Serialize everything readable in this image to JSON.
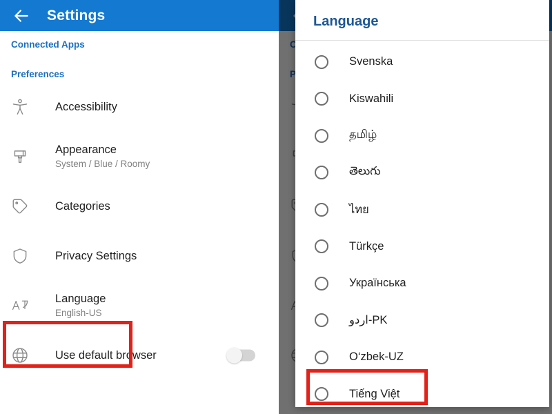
{
  "app": {
    "title": "Settings",
    "back_icon": "back-arrow-icon",
    "header_color": "#1479d1"
  },
  "settings": {
    "sections": [
      {
        "label": "Connected Apps"
      },
      {
        "label": "Preferences"
      }
    ],
    "items": [
      {
        "icon": "accessibility-icon",
        "title": "Accessibility",
        "subtitle": ""
      },
      {
        "icon": "paintbrush-icon",
        "title": "Appearance",
        "subtitle": "System / Blue / Roomy"
      },
      {
        "icon": "tag-icon",
        "title": "Categories",
        "subtitle": ""
      },
      {
        "icon": "shield-icon",
        "title": "Privacy Settings",
        "subtitle": ""
      },
      {
        "icon": "translate-icon",
        "title": "Language",
        "subtitle": "English-US"
      },
      {
        "icon": "globe-icon",
        "title": "Use default browser",
        "subtitle": "",
        "toggle": "off"
      }
    ]
  },
  "dialog": {
    "title": "Language",
    "options": [
      {
        "label": "Svenska",
        "selected": false
      },
      {
        "label": "Kiswahili",
        "selected": false
      },
      {
        "label": "தமிழ்",
        "selected": false
      },
      {
        "label": "తెలుగు",
        "selected": false
      },
      {
        "label": "ไทย",
        "selected": false
      },
      {
        "label": "Türkçe",
        "selected": false
      },
      {
        "label": "Українська",
        "selected": false
      },
      {
        "label": "اردو-PK",
        "selected": false
      },
      {
        "label": "O‘zbek-UZ",
        "selected": false
      },
      {
        "label": "Tiếng Việt",
        "selected": false
      }
    ]
  },
  "annotations": {
    "highlight_color": "#e32119",
    "boxes": [
      {
        "target": "language-row",
        "panel": "left"
      },
      {
        "target": "option-tieng-viet",
        "panel": "right"
      }
    ]
  }
}
